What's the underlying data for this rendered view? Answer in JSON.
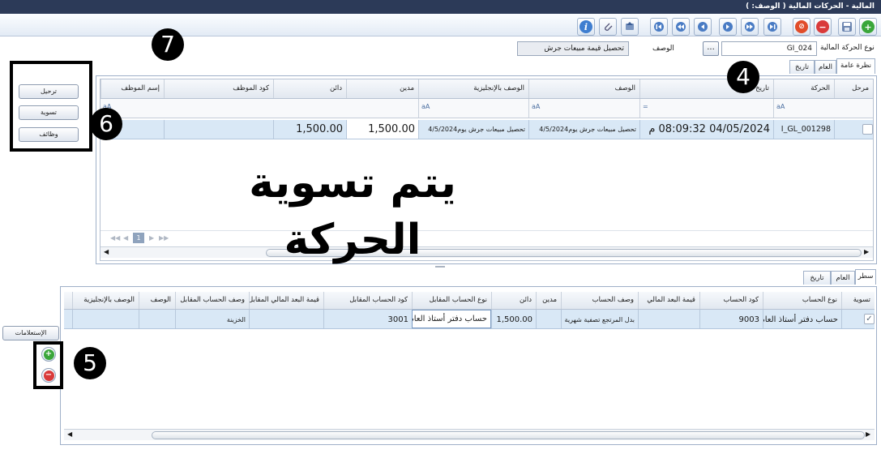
{
  "window": {
    "title": "المالية - الحركات المالية  ( الوصف: )"
  },
  "toolbar": {
    "icons": [
      "add-icon",
      "save-icon",
      "remove-icon",
      "cancel-icon",
      "last-icon",
      "next-icon",
      "fast-next-icon",
      "prev-icon",
      "fast-prev-icon",
      "first-icon",
      "export-icon",
      "attach-icon",
      "info-icon"
    ]
  },
  "header": {
    "type_label": "نوع الحركة المالية",
    "type_value": "GI_024",
    "lookup_label": "...",
    "desc_label": "الوصف",
    "desc_value": "تحصيل قيمة مبيعات جرش"
  },
  "top_tabs": [
    "نظرة عامة",
    "العام",
    "تاريخ"
  ],
  "top_grid": {
    "columns": [
      "مرحل",
      "الحركة",
      "تاريخ",
      "الوصف",
      "الوصف بالإنجليزية",
      "مدين",
      "دائن",
      "كود الموظف",
      "إسم الموظف"
    ],
    "filter_glyph": "aA",
    "date_filter_glyph": "=",
    "row": {
      "posted": "",
      "movement": "‎I_GL_001298",
      "date": "04/05/2024 08:09:32 م",
      "description": "تحصيل مبيعات جرش يوم4/5/2024",
      "description_en": "تحصيل مبيعات جرش يوم4/5/2024",
      "debit": "1,500.00",
      "credit": "1,500.00",
      "employee_code": "",
      "employee_name": ""
    },
    "pager": {
      "page": "1"
    }
  },
  "side_buttons": [
    "ترحيل",
    "تسوية",
    "وظائف"
  ],
  "bottom_tabs": [
    "سطر",
    "العام",
    "تاريخ"
  ],
  "bottom_grid": {
    "columns": [
      "تسوية",
      "نوع الحساب",
      "كود الحساب",
      "قيمة البعد المالي",
      "وصف الحساب",
      "مدين",
      "دائن",
      "نوع الحساب المقابل",
      "كود الحساب المقابل",
      "قيمة البعد المالي المقابل",
      "وصف الحساب المقابل",
      "الوصف",
      "الوصف بالإنجليزية"
    ],
    "row": {
      "settled": "✓",
      "account_type": "حساب دفتر أستاذ العام",
      "account_code": "9003",
      "dimension": "",
      "account_desc": "بدل المرتجع تصفية شهرية",
      "debit": "",
      "credit": "1,500.00",
      "offset_type": "حساب دفتر أستاذ العام",
      "offset_code": "3001",
      "offset_dimension": "",
      "offset_desc": "الخزينة",
      "desc": "",
      "desc_en": ""
    }
  },
  "queries_button": "الإستعلامات",
  "annotations": {
    "badge_4": "4",
    "badge_5": "5",
    "badge_6": "6",
    "badge_7": "7",
    "overlay_line1": "يتم تسوية",
    "overlay_line2": "الحركة"
  },
  "colors": {
    "titlebar": "#2c3a58",
    "selected_row": "#d9e8f6"
  }
}
